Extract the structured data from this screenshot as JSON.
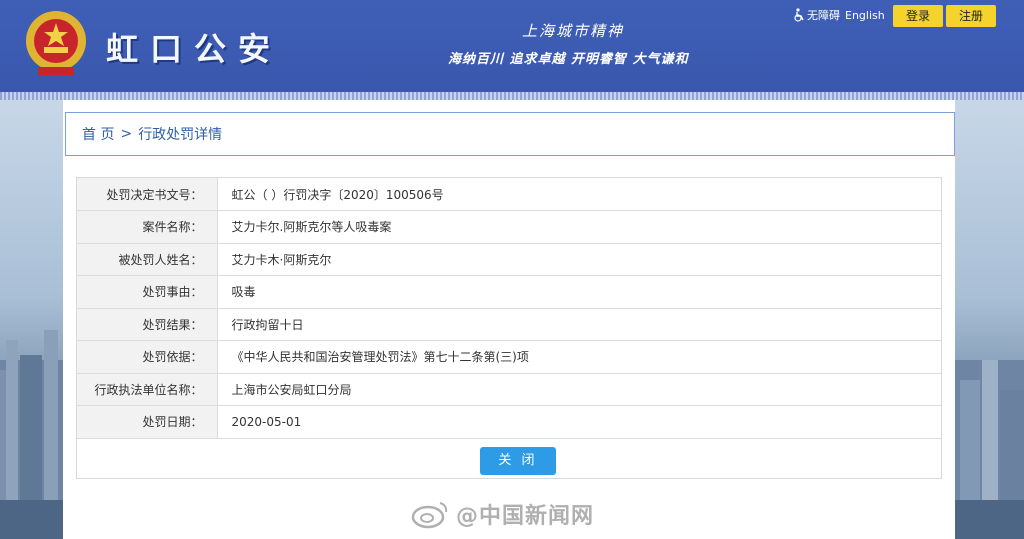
{
  "header": {
    "site_title": "虹口公安",
    "spirit_title": "上海城市精神",
    "spirit_motto": "海纳百川 追求卓越 开明睿智 大气谦和",
    "accessibility_label": "无障碍",
    "english_label": "English",
    "login_label": "登录",
    "register_label": "注册",
    "brand_color": "#3f5fb7",
    "button_color": "#f4d42c"
  },
  "breadcrumb": {
    "home": "首 页",
    "separator": ">",
    "current": "行政处罚详情"
  },
  "details": [
    {
      "label": "处罚决定书文号：",
      "value": "虹公（ ）行罚决字〔2020〕100506号"
    },
    {
      "label": "案件名称：",
      "value": "艾力卡尔.阿斯克尔等人吸毒案"
    },
    {
      "label": "被处罚人姓名：",
      "value": "艾力卡木·阿斯克尔"
    },
    {
      "label": "处罚事由：",
      "value": "吸毒"
    },
    {
      "label": "处罚结果：",
      "value": "行政拘留十日"
    },
    {
      "label": "处罚依据：",
      "value": "《中华人民共和国治安管理处罚法》第七十二条第(三)项"
    },
    {
      "label": "行政执法单位名称：",
      "value": "上海市公安局虹口分局"
    },
    {
      "label": "处罚日期：",
      "value": "2020-05-01"
    }
  ],
  "actions": {
    "close_label": "关 闭",
    "close_color": "#2d9be6"
  },
  "watermark": {
    "text": "@中国新闻网"
  }
}
